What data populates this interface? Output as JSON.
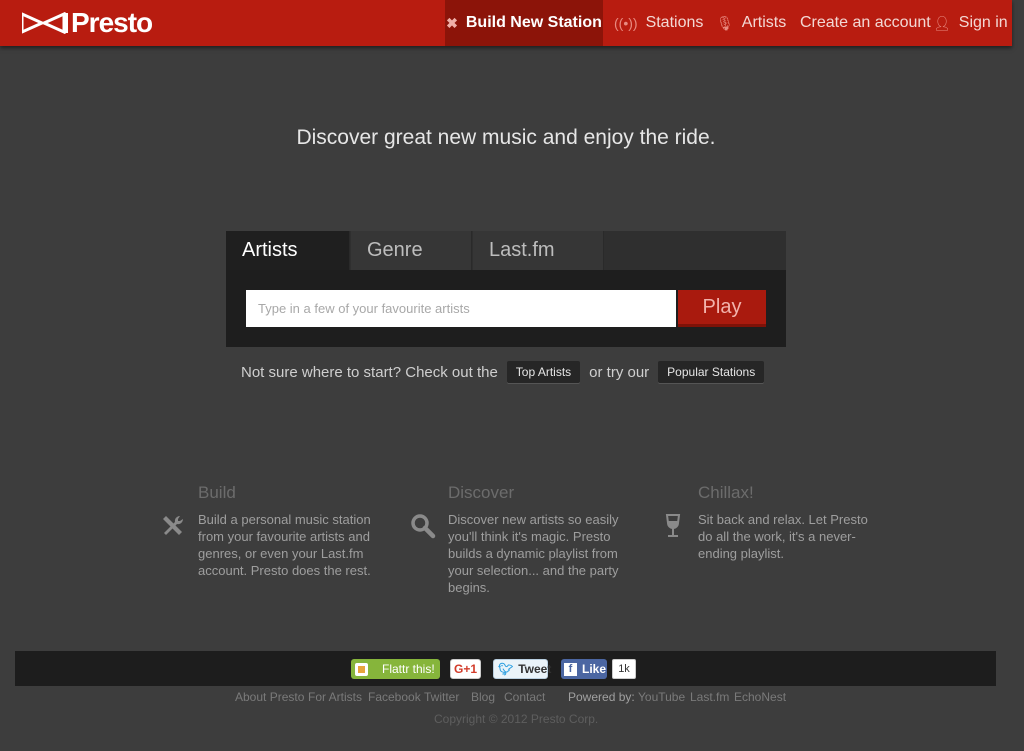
{
  "header": {
    "brand": "Presto",
    "nav": {
      "build": "Build New Station",
      "stations": "Stations",
      "artists": "Artists",
      "create": "Create an account",
      "signin": "Sign in"
    }
  },
  "hero": {
    "tagline": "Discover great new music and enjoy the ride."
  },
  "panel": {
    "tabs": [
      "Artists",
      "Genre",
      "Last.fm"
    ],
    "active_tab": "Artists",
    "search_placeholder": "Type in a few of your favourite artists",
    "search_value": "",
    "play_label": "Play"
  },
  "hint": {
    "prefix": "Not sure where to start? Check out the",
    "top_artists": "Top Artists",
    "middle": "or try our",
    "popular_stations": "Popular Stations"
  },
  "features": [
    {
      "icon": "tools-icon",
      "title": "Build",
      "text": "Build a personal music station from your favourite artists and genres, or even your Last.fm account. Presto does the rest."
    },
    {
      "icon": "magnifier-icon",
      "title": "Discover",
      "text": "Discover new artists so easily you'll think it's magic. Presto builds a dynamic playlist from your selection... and the party begins."
    },
    {
      "icon": "wine-glass-icon",
      "title": "Chillax!",
      "text": "Sit back and relax. Let Presto do all the work, it's a never-ending playlist."
    }
  ],
  "social": {
    "flattr": "Flattr this!",
    "gplus": "G+1",
    "tweet": "Tweet",
    "like": "Like",
    "like_count": "1k"
  },
  "footer": {
    "links": [
      "About Presto",
      "For Artists",
      "Facebook",
      "Twitter",
      "Blog",
      "Contact"
    ],
    "powered_by": "Powered by:",
    "powered_links": [
      "YouTube",
      "Last.fm",
      "EchoNest"
    ],
    "copyright": "Copyright © 2012 Presto Corp."
  },
  "colors": {
    "brand_red": "#b81c10",
    "active_nav": "#8c1409",
    "background": "#3d3d3d"
  }
}
